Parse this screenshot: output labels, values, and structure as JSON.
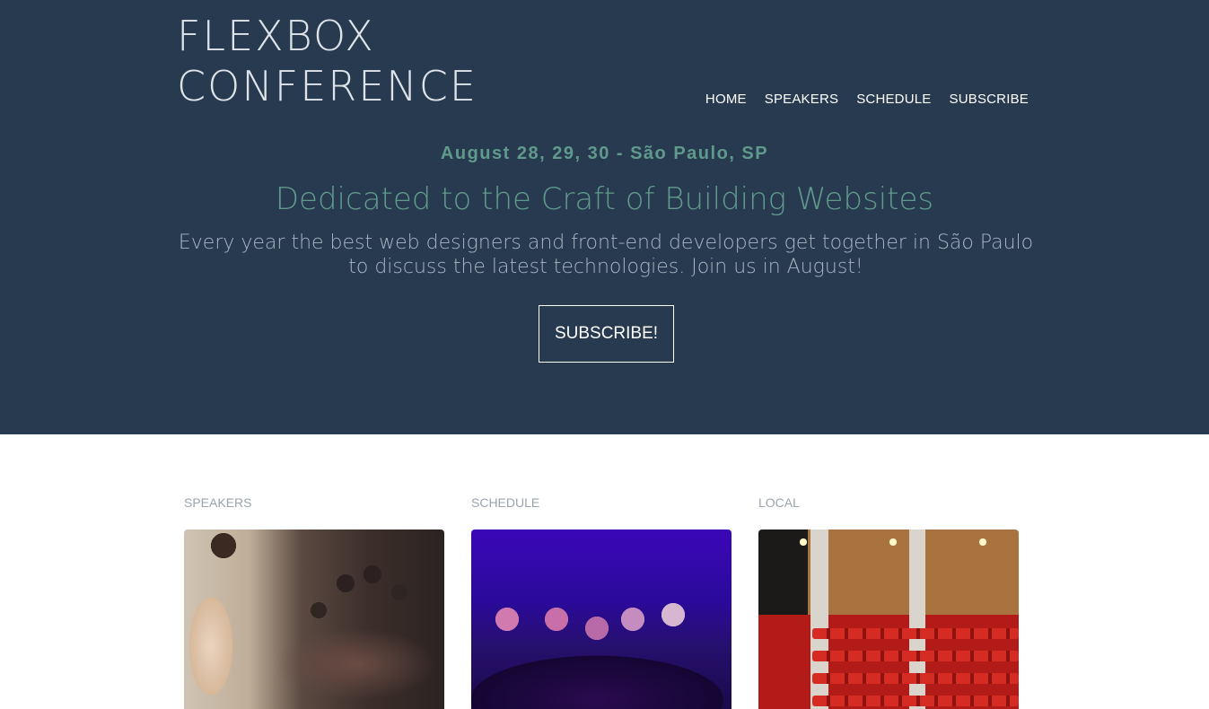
{
  "header": {
    "logo_line1": "FLEXBOX",
    "logo_line2": "CONFERENCE",
    "nav": [
      {
        "label": "HOME"
      },
      {
        "label": "SPEAKERS"
      },
      {
        "label": "SCHEDULE"
      },
      {
        "label": "SUBSCRIBE"
      }
    ]
  },
  "hero": {
    "date_location": "August 28, 29, 30 - São Paulo, SP",
    "tagline": "Dedicated to the Craft of Building Websites",
    "description": "Every year the best web designers and front-end developers get together in São Paulo to discuss the latest technologies. Join us in August!",
    "cta_label": "SUBSCRIBE!"
  },
  "sections": [
    {
      "title": "SPEAKERS",
      "image": "audience-listening-photo"
    },
    {
      "title": "SCHEDULE",
      "image": "theater-audience-purple-photo"
    },
    {
      "title": "LOCAL",
      "image": "auditorium-red-seats-photo"
    }
  ],
  "colors": {
    "hero_bg": "#283a4f",
    "accent_green": "#5f9a8c",
    "text_light": "#a9b5c2",
    "white": "#ffffff"
  }
}
